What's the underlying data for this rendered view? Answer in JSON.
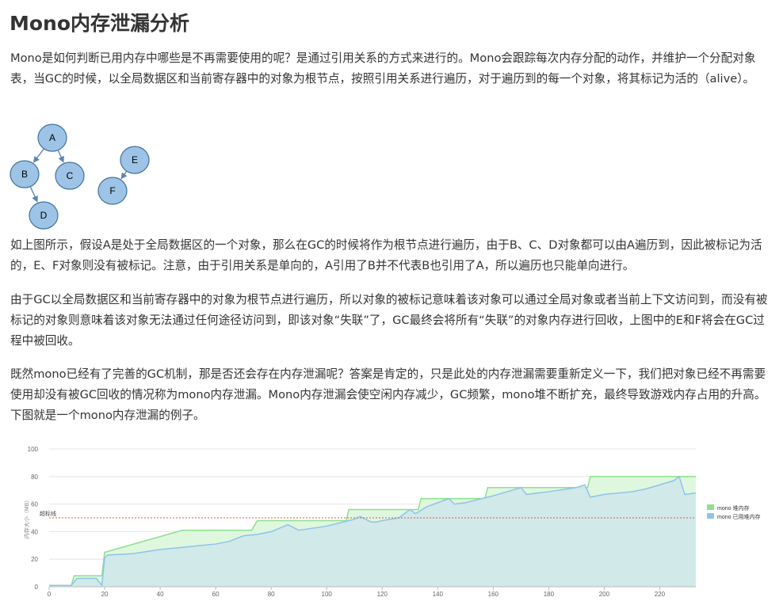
{
  "article": {
    "title": "Mono内存泄漏分析",
    "p1": "Mono是如何判断已用内存中哪些是不再需要使用的呢？是通过引用关系的方式来进行的。Mono会跟踪每次内存分配的动作，并维护一个分配对象表，当GC的时候，以全局数据区和当前寄存器中的对象为根节点，按照引用关系进行遍历，对于遍历到的每一个对象，将其标记为活的（alive）。",
    "p2": "如上图所示，假设A是处于全局数据区的一个对象，那么在GC的时候将作为根节点进行遍历，由于B、C、D对象都可以由A遍历到，因此被标记为活的，E、F对象则没有被标记。注意，由于引用关系是单向的，A引用了B并不代表B也引用了A，所以遍历也只能单向进行。",
    "p3": "由于GC以全局数据区和当前寄存器中的对象为根节点进行遍历，所以对象的被标记意味着该对象可以通过全局对象或者当前上下文访问到，而没有被标记的对象则意味着该对象无法通过任何途径访问到，即该对象“失联”了，GC最终会将所有“失联”的对象内存进行回收，上图中的E和F将会在GC过程中被回收。",
    "p4": "既然mono已经有了完善的GC机制，那是否还会存在内存泄漏呢？答案是肯定的，只是此处的内存泄漏需要重新定义一下，我们把对象已经不再需要使用却没有被GC回收的情况称为mono内存泄漏。Mono内存泄漏会使空闲内存减少，GC频繁，mono堆不断扩充，最终导致游戏内存占用的升高。下图就是一个mono内存泄漏的例子。"
  },
  "diagram": {
    "nodes": [
      {
        "id": "A",
        "label": "A"
      },
      {
        "id": "B",
        "label": "B"
      },
      {
        "id": "C",
        "label": "C"
      },
      {
        "id": "D",
        "label": "D"
      },
      {
        "id": "E",
        "label": "E"
      },
      {
        "id": "F",
        "label": "F"
      }
    ],
    "edges": [
      {
        "from": "A",
        "to": "B"
      },
      {
        "from": "A",
        "to": "C"
      },
      {
        "from": "B",
        "to": "D"
      },
      {
        "from": "E",
        "to": "F"
      }
    ],
    "node_fill": "#9dc3e6",
    "node_stroke": "#41719c"
  },
  "chart_data": {
    "type": "area",
    "ylabel": "内存大小（MB）",
    "xlim": [
      0,
      233
    ],
    "ylim": [
      0,
      100
    ],
    "x_ticks": [
      0,
      20,
      40,
      60,
      80,
      100,
      120,
      140,
      160,
      180,
      200,
      220
    ],
    "y_ticks": [
      0,
      20,
      40,
      60,
      80,
      100
    ],
    "grid": true,
    "legend_position": "right",
    "threshold": {
      "label": "超标线",
      "value": 50,
      "color": "#e05555"
    },
    "series": [
      {
        "name": "mono 堆内存",
        "color": "#8fe08f",
        "fill": "#dff7df",
        "x": [
          0,
          8,
          9,
          10,
          19,
          20,
          48,
          73,
          75,
          107,
          108,
          133,
          134,
          157,
          158,
          194,
          195,
          233
        ],
        "y": [
          1,
          1,
          8,
          8,
          8,
          25,
          41,
          41,
          48,
          48,
          56,
          56,
          64,
          64,
          72,
          72,
          80,
          80
        ]
      },
      {
        "name": "mono 已用堆内存",
        "color": "#8ec3ec",
        "fill": "#cfe6ea",
        "x": [
          0,
          8,
          10,
          17,
          19,
          20,
          21,
          30,
          40,
          50,
          55,
          60,
          65,
          70,
          75,
          80,
          86,
          90,
          100,
          110,
          112,
          116,
          118,
          120,
          126,
          130,
          132,
          136,
          140,
          144,
          146,
          150,
          160,
          170,
          172,
          180,
          190,
          193,
          195,
          200,
          210,
          215,
          220,
          225,
          227,
          229,
          233
        ],
        "y": [
          1,
          1,
          6,
          6,
          1,
          21,
          23,
          24,
          27,
          29,
          30,
          31,
          33,
          37,
          38,
          40,
          45,
          41,
          44,
          49,
          51,
          47,
          47,
          48,
          50,
          56,
          53,
          58,
          61,
          64,
          60,
          61,
          66,
          72,
          67,
          69,
          72,
          74,
          65,
          67,
          69,
          71,
          74,
          77,
          80,
          67,
          68
        ]
      }
    ]
  }
}
